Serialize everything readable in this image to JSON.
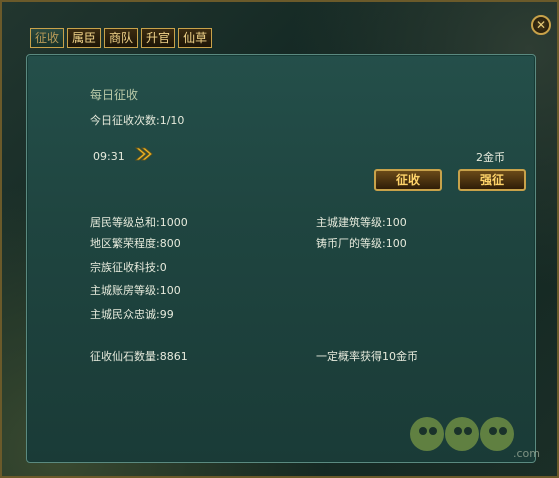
{
  "tabs": [
    {
      "label": "征收",
      "active": true
    },
    {
      "label": "属臣",
      "active": false
    },
    {
      "label": "商队",
      "active": false
    },
    {
      "label": "升官",
      "active": false
    },
    {
      "label": "仙草",
      "active": false
    }
  ],
  "panel": {
    "title": "每日征收",
    "count_text": "今日征收次数:1/10",
    "timer": "09:31",
    "cost": "2金币",
    "collect_button": "征收",
    "force_button": "强征",
    "stats_left": [
      "居民等级总和:1000",
      "地区繁荣程度:800",
      "宗族征收科技:0",
      "主城账房等级:100",
      "主城民众忠诚:99"
    ],
    "stats_right": [
      "主城建筑等级:100",
      "铸币厂的等级:100"
    ],
    "stone_count": "征收仙石数量:8861",
    "chance_text": "一定概率获得10金币"
  },
  "watermark": {
    "text": "4399",
    "domain": ".com"
  },
  "colors": {
    "gold": "#c8a24a",
    "panel": "#1f4540",
    "text": "#e6eadc"
  }
}
